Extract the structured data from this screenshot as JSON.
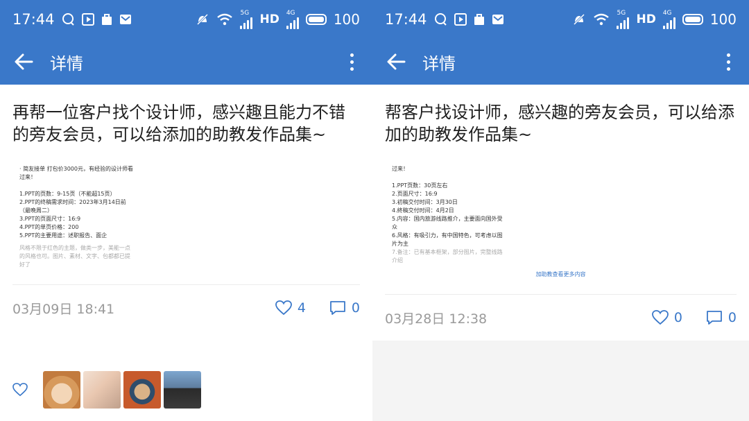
{
  "status_bar": {
    "time": "17:44",
    "net_5g": "5G",
    "net_4g": "4G",
    "hd": "HD",
    "battery": "100"
  },
  "toolbar": {
    "title": "详情"
  },
  "left": {
    "post_text": "再帮一位客户找个设计师，感兴趣且能力不错的旁友会员，可以给添加的助教发作品集~",
    "attachment_lines": [
      "· 简友接单 打包价3000元，有经验的设计师看",
      "过来！",
      "",
      "1.PPT的页数：9-15页（不能超15页）",
      "2.PPT的终稿需求时间：2023年3月14日前",
      "（最晚周二）",
      "3.PPT的页面尺寸：16:9",
      "4.PPT的单页价格：200",
      "5.PPT的主要用途：述职报告、面企"
    ],
    "attachment_faint": [
      "风格不限于红色的主题，做类一步，美能一点",
      "的风格也可。图片、素材、文字、包都都已提",
      "好了"
    ],
    "date": "03月09日 18:41",
    "like_count": "4",
    "comment_count": "0"
  },
  "right": {
    "post_text": "帮客户找设计师，感兴趣的旁友会员，可以给添加的助教发作品集~",
    "attachment_lines": [
      "过来！",
      "",
      "1.PPT页数：30页左右",
      "2.页面尺寸：16:9",
      "3.初稿交付时间：3月30日",
      "4.終稿交付时间：4月2日",
      "5.内容：国内旅游线路推介，主要面向国外受",
      "众",
      "6.风格：有吸引力，有中国特色，可考虑以图",
      "片为主"
    ],
    "attachment_faint": [
      "7.备注：已有基本框架，部分图片，完整线路",
      "介绍"
    ],
    "attachment_link": "加助教查看更多内容",
    "date": "03月28日 12:38",
    "like_count": "0",
    "comment_count": "0"
  },
  "colors": {
    "primary": "#3a78c9",
    "meta_gray": "#9a9a9a"
  },
  "icons": [
    "back-arrow-icon",
    "more-vertical-icon",
    "heart-icon",
    "comment-icon",
    "wifi-icon",
    "mute-icon"
  ]
}
